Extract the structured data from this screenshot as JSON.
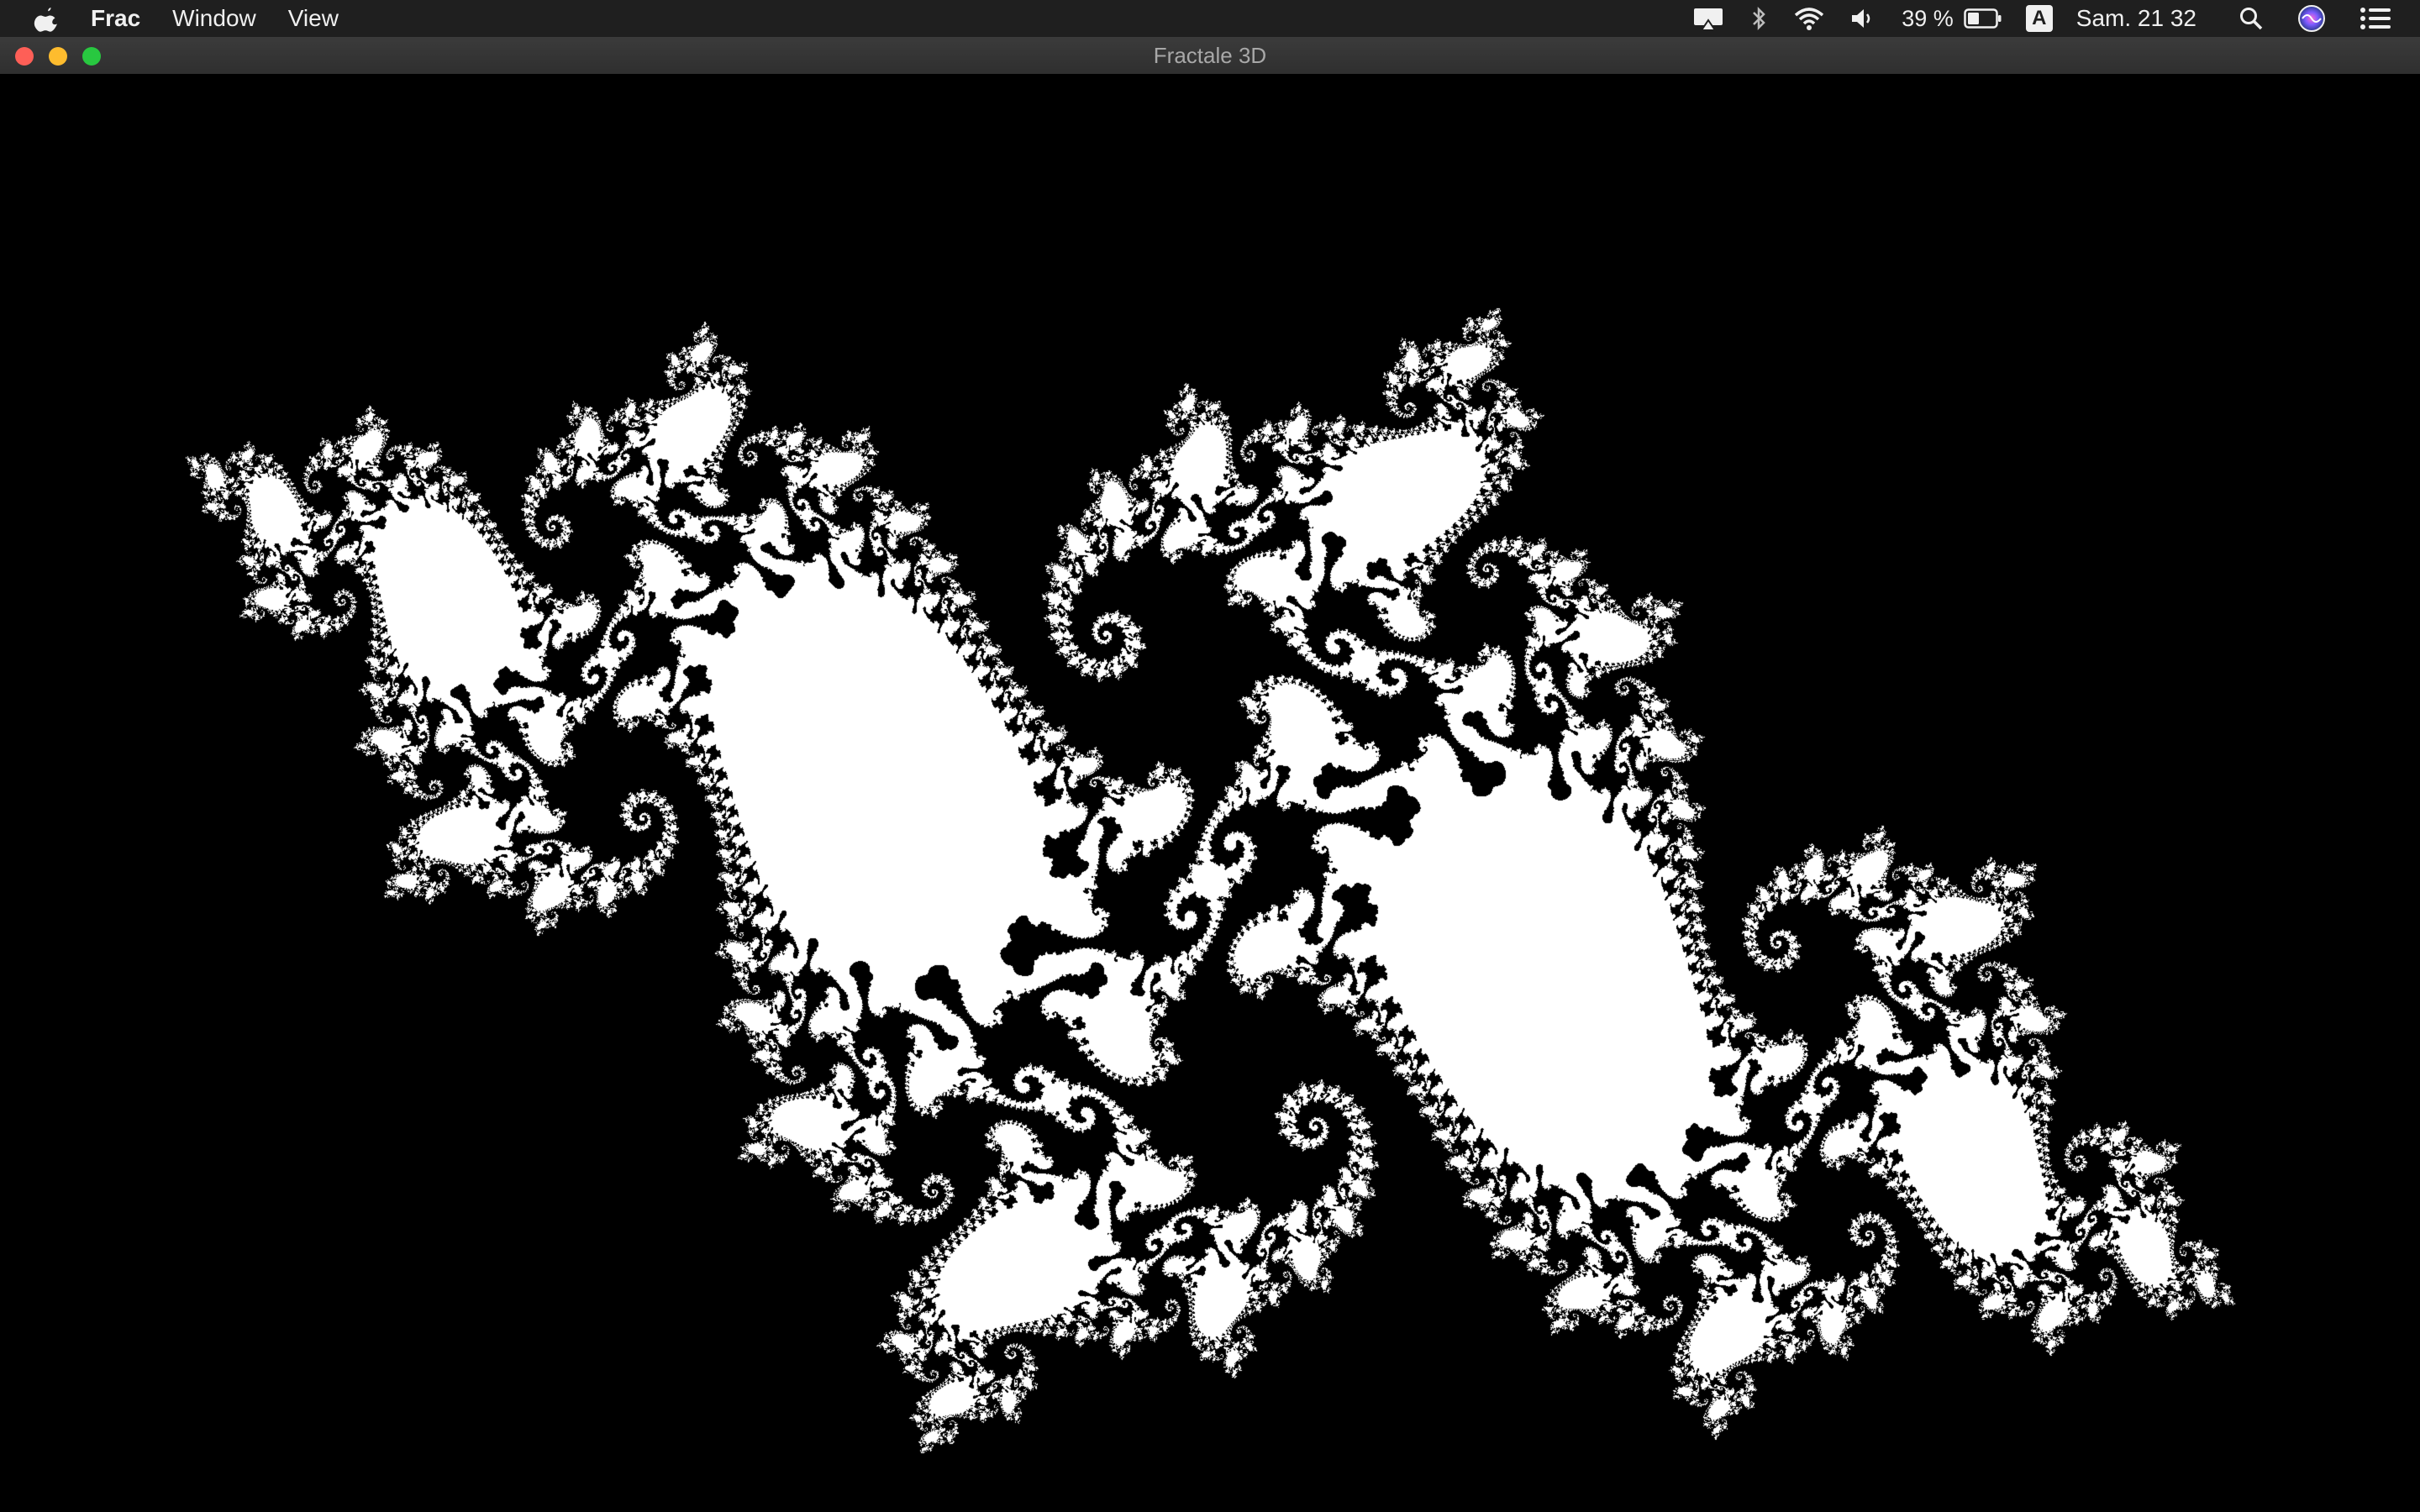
{
  "menubar": {
    "app_name": "Frac",
    "items": [
      "Window",
      "View"
    ],
    "battery_percent": "39 %",
    "input_source": "A",
    "clock": "Sam. 21 32"
  },
  "window": {
    "title": "Fractale 3D"
  },
  "colors": {
    "menubar_bg": "#1f1f1f",
    "titlebar_bg": "#353535",
    "canvas_bg": "#000000",
    "fractal_fill": "#ffffff"
  },
  "icons": {
    "apple": "apple-logo-icon",
    "airplay": "airplay-display-icon",
    "bluetooth": "bluetooth-icon",
    "wifi": "wifi-icon",
    "volume": "speaker-volume-icon",
    "battery": "battery-icon",
    "spotlight": "search-icon",
    "siri": "siri-icon",
    "notifications": "notification-center-icon"
  }
}
